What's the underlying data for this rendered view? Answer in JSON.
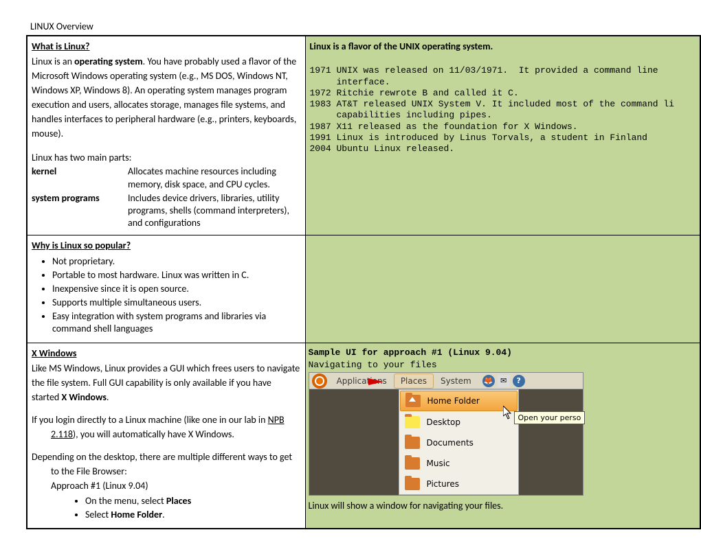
{
  "title": "LINUX Overview",
  "cell1": {
    "heading": "What is Linux?",
    "intro_pre": "Linux is an ",
    "intro_bold": "operating system",
    "intro_post": ".  You have probably used a flavor of the Microsoft Windows operating system (e.g., MS DOS, Windows NT, Windows XP, Windows 8).  An operating system manages program execution and users,  allocates storage, manages file systems, and handles interfaces to peripheral hardware (e.g., printers, keyboards, mouse).",
    "parts_intro": "Linux has two main parts:",
    "kernel_label": "kernel",
    "kernel_desc": "Allocates machine resources including memory, disk space, and CPU cycles.",
    "sys_label": "system programs",
    "sys_desc": "Includes device drivers, libraries, utility programs, shells (command interpreters), and configurations"
  },
  "cell2": {
    "heading": "Linux is a flavor of the UNIX operating system.",
    "timeline": [
      "1971 UNIX was released on 11/03/1971.  It provided a command line",
      "     interface.",
      "1972 Ritchie rewrote B and called it C.",
      "1983 AT&T released UNIX System V. It included most of the command li",
      "     capabilities including pipes.",
      "1987 X11 released as the foundation for X Windows.",
      "1991 Linux is introduced by Linus Torvals, a student in Finland",
      "2004 Ubuntu Linux released."
    ]
  },
  "cell3": {
    "heading": "Why is Linux so popular?",
    "bullets": [
      "Not proprietary.",
      "Portable to most hardware.  Linux was written in C.",
      "Inexpensive since it is open source.",
      "Supports multiple simultaneous users.",
      "Easy integration with system programs and libraries via command shell languages"
    ]
  },
  "cell4": {
    "heading": "X Windows",
    "p1_pre": "Like MS Windows, Linux provides a GUI which frees users to navigate the file system.  Full GUI capability is only available if you have started ",
    "p1_bold": "X Windows",
    "p1_post": ".",
    "p2_pre": "If you login directly to a Linux machine (like one in our lab in ",
    "p2_link": "NPB 2.118",
    "p2_post": "), you will automatically have X Windows.",
    "p3": "Depending on the desktop, there are multiple different ways to get to the File Browser:",
    "approach_label": "Approach #1 (Linux 9.04)",
    "b1_pre": "On the menu, select ",
    "b1_bold": "Places",
    "b2_pre": "Select ",
    "b2_bold": "Home Folder",
    "b2_post": "."
  },
  "cell5": {
    "heading": "Sample UI for approach #1 (Linux 9.04)",
    "subheading": "Navigating to your files",
    "menubar": {
      "applications": "Applications",
      "places": "Places",
      "system": "System"
    },
    "dropdown": {
      "home": "Home Folder",
      "desktop": "Desktop",
      "documents": "Documents",
      "music": "Music",
      "pictures": "Pictures"
    },
    "tooltip": "Open your perso",
    "footer": "Linux will show a window for navigating your files."
  }
}
